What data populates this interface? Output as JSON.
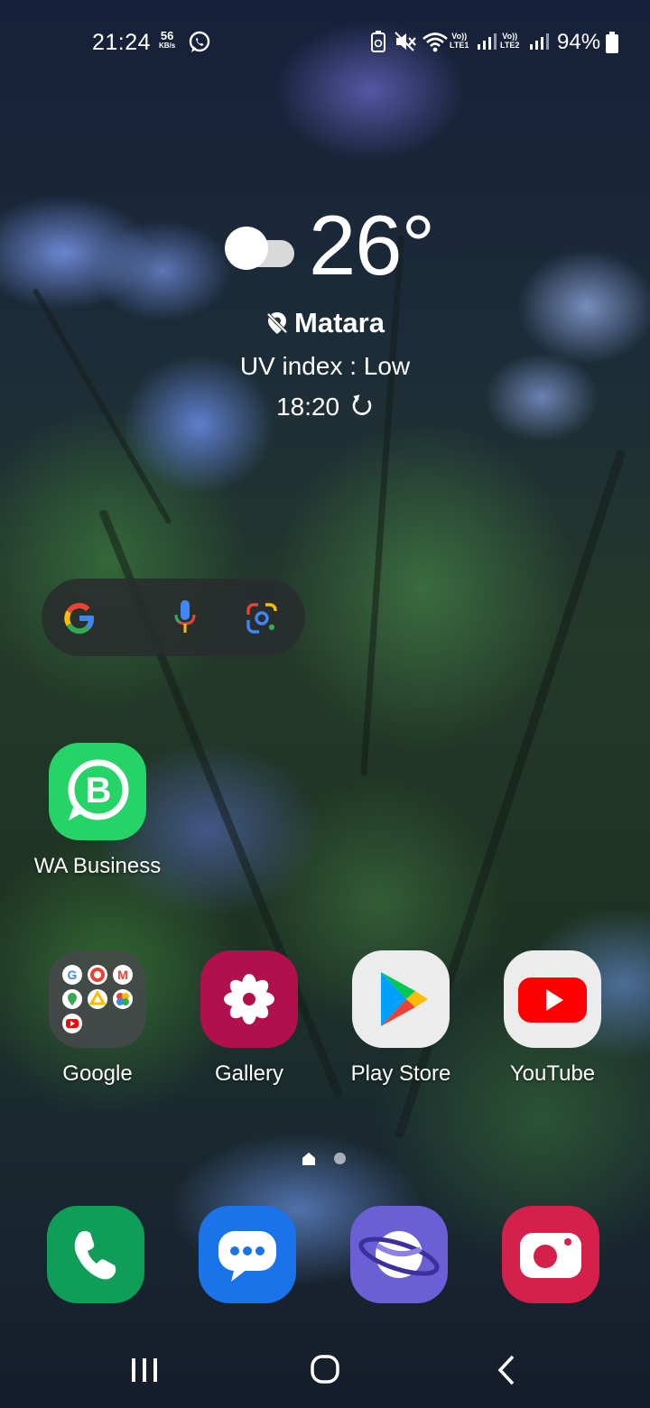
{
  "status_bar": {
    "time": "21:24",
    "net_speed_value": "56",
    "net_speed_unit": "KB/s",
    "sim1": "LTE1",
    "sim2": "LTE2",
    "volte": "Vo))",
    "battery": "94%",
    "icons": [
      "whatsapp-icon",
      "battery-saver-icon",
      "mute-icon",
      "wifi-icon",
      "signal-icon",
      "battery-icon"
    ]
  },
  "weather": {
    "temperature": "26°",
    "location": "Matara",
    "uv": "UV index : Low",
    "updated": "18:20",
    "icon": "partly-cloudy-icon"
  },
  "search_widget": {
    "icons": [
      "google-g-icon",
      "voice-mic-icon",
      "google-lens-icon"
    ]
  },
  "apps": {
    "wa_business": "WA Business",
    "google": "Google",
    "gallery": "Gallery",
    "play_store": "Play Store",
    "youtube": "YouTube"
  },
  "dock": [
    "phone-icon",
    "messages-icon",
    "samsung-internet-icon",
    "camera-icon"
  ],
  "pages": {
    "count": 2,
    "current": 1
  },
  "navbar": [
    "recents-button",
    "home-button",
    "back-button"
  ],
  "colors": {
    "whatsapp_green": "#25D366",
    "gallery": "#B0114C",
    "youtube_red": "#FF0000",
    "phone_green": "#0F9D58",
    "messages_blue": "#1A73E8",
    "internet_purple": "#6B5FD6",
    "camera_red": "#D4204A"
  }
}
